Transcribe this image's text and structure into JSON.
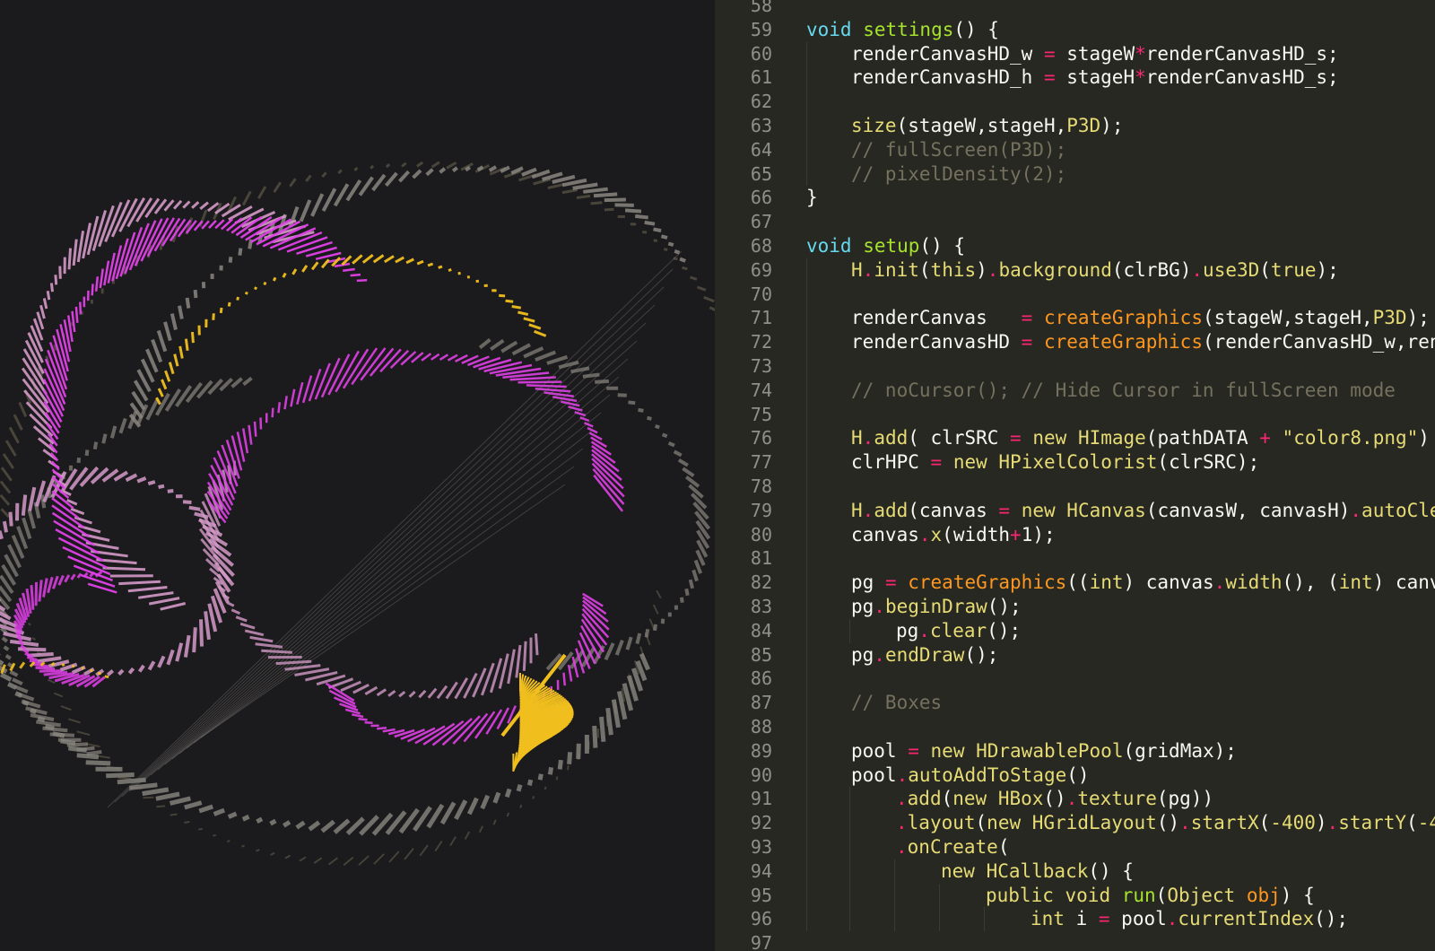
{
  "colors": {
    "canvas_bg": "#1b1a1c",
    "editor_bg": "#272822",
    "magenta": "#e040e8",
    "pink": "#d49ac8",
    "gold": "#f0bf1e",
    "gray": "#8a8780",
    "olive": "#6f6a55"
  },
  "editor": {
    "lines": [
      {
        "num": "58",
        "indent": 0,
        "tokens": []
      },
      {
        "num": "59",
        "indent": 0,
        "tokens": [
          {
            "t": "void ",
            "c": "kw2"
          },
          {
            "t": "settings",
            "c": "fn"
          },
          {
            "t": "() {",
            "c": "plain"
          }
        ]
      },
      {
        "num": "60",
        "indent": 1,
        "tokens": [
          {
            "t": "renderCanvasHD_w ",
            "c": "plain"
          },
          {
            "t": "=",
            "c": "op"
          },
          {
            "t": " stageW",
            "c": "plain"
          },
          {
            "t": "*",
            "c": "op"
          },
          {
            "t": "renderCanvasHD_s;",
            "c": "plain"
          }
        ]
      },
      {
        "num": "61",
        "indent": 1,
        "tokens": [
          {
            "t": "renderCanvasHD_h ",
            "c": "plain"
          },
          {
            "t": "=",
            "c": "op"
          },
          {
            "t": " stageH",
            "c": "plain"
          },
          {
            "t": "*",
            "c": "op"
          },
          {
            "t": "renderCanvasHD_s;",
            "c": "plain"
          }
        ]
      },
      {
        "num": "62",
        "indent": 0,
        "tokens": []
      },
      {
        "num": "63",
        "indent": 1,
        "tokens": [
          {
            "t": "size",
            "c": "call"
          },
          {
            "t": "(stageW,stageH,",
            "c": "plain"
          },
          {
            "t": "P3D",
            "c": "call"
          },
          {
            "t": ");",
            "c": "plain"
          }
        ]
      },
      {
        "num": "64",
        "indent": 1,
        "tokens": [
          {
            "t": "// fullScreen(P3D);",
            "c": "cm"
          }
        ]
      },
      {
        "num": "65",
        "indent": 1,
        "tokens": [
          {
            "t": "// pixelDensity(2);",
            "c": "cm"
          }
        ]
      },
      {
        "num": "66",
        "indent": 0,
        "tokens": [
          {
            "t": "}",
            "c": "plain"
          }
        ]
      },
      {
        "num": "67",
        "indent": 0,
        "tokens": []
      },
      {
        "num": "68",
        "indent": 0,
        "tokens": [
          {
            "t": "void ",
            "c": "kw2"
          },
          {
            "t": "setup",
            "c": "fn"
          },
          {
            "t": "() {",
            "c": "plain"
          }
        ]
      },
      {
        "num": "69",
        "indent": 1,
        "tokens": [
          {
            "t": "H",
            "c": "call"
          },
          {
            "t": ".",
            "c": "op"
          },
          {
            "t": "init",
            "c": "call"
          },
          {
            "t": "(",
            "c": "plain"
          },
          {
            "t": "this",
            "c": "call"
          },
          {
            "t": ")",
            "c": "plain"
          },
          {
            "t": ".",
            "c": "op"
          },
          {
            "t": "background",
            "c": "call"
          },
          {
            "t": "(clrBG)",
            "c": "plain"
          },
          {
            "t": ".",
            "c": "op"
          },
          {
            "t": "use3D",
            "c": "call"
          },
          {
            "t": "(",
            "c": "plain"
          },
          {
            "t": "true",
            "c": "call"
          },
          {
            "t": ");",
            "c": "plain"
          }
        ]
      },
      {
        "num": "70",
        "indent": 0,
        "tokens": []
      },
      {
        "num": "71",
        "indent": 1,
        "tokens": [
          {
            "t": "renderCanvas   ",
            "c": "plain"
          },
          {
            "t": "=",
            "c": "op"
          },
          {
            "t": " ",
            "c": "plain"
          },
          {
            "t": "createGraphics",
            "c": "const"
          },
          {
            "t": "(stageW,stageH,",
            "c": "plain"
          },
          {
            "t": "P3D",
            "c": "call"
          },
          {
            "t": ");",
            "c": "plain"
          }
        ]
      },
      {
        "num": "72",
        "indent": 1,
        "tokens": [
          {
            "t": "renderCanvasHD ",
            "c": "plain"
          },
          {
            "t": "=",
            "c": "op"
          },
          {
            "t": " ",
            "c": "plain"
          },
          {
            "t": "createGraphics",
            "c": "const"
          },
          {
            "t": "(renderCanvasHD_w,rend",
            "c": "plain"
          }
        ]
      },
      {
        "num": "73",
        "indent": 0,
        "tokens": []
      },
      {
        "num": "74",
        "indent": 1,
        "tokens": [
          {
            "t": "// noCursor(); // Hide Cursor in fullScreen mode",
            "c": "cm"
          }
        ]
      },
      {
        "num": "75",
        "indent": 0,
        "tokens": []
      },
      {
        "num": "76",
        "indent": 1,
        "tokens": [
          {
            "t": "H",
            "c": "call"
          },
          {
            "t": ".",
            "c": "op"
          },
          {
            "t": "add",
            "c": "call"
          },
          {
            "t": "( clrSRC ",
            "c": "plain"
          },
          {
            "t": "=",
            "c": "op"
          },
          {
            "t": " ",
            "c": "plain"
          },
          {
            "t": "new ",
            "c": "call"
          },
          {
            "t": "HImage",
            "c": "call"
          },
          {
            "t": "(pathDATA ",
            "c": "plain"
          },
          {
            "t": "+",
            "c": "op"
          },
          {
            "t": " ",
            "c": "plain"
          },
          {
            "t": "\"color8.png\"",
            "c": "str"
          },
          {
            "t": ")",
            "c": "plain"
          }
        ]
      },
      {
        "num": "77",
        "indent": 1,
        "tokens": [
          {
            "t": "clrHPC ",
            "c": "plain"
          },
          {
            "t": "=",
            "c": "op"
          },
          {
            "t": " ",
            "c": "plain"
          },
          {
            "t": "new ",
            "c": "call"
          },
          {
            "t": "HPixelColorist",
            "c": "call"
          },
          {
            "t": "(clrSRC);",
            "c": "plain"
          }
        ]
      },
      {
        "num": "78",
        "indent": 0,
        "tokens": []
      },
      {
        "num": "79",
        "indent": 1,
        "tokens": [
          {
            "t": "H",
            "c": "call"
          },
          {
            "t": ".",
            "c": "op"
          },
          {
            "t": "add",
            "c": "call"
          },
          {
            "t": "(canvas ",
            "c": "plain"
          },
          {
            "t": "=",
            "c": "op"
          },
          {
            "t": " ",
            "c": "plain"
          },
          {
            "t": "new ",
            "c": "call"
          },
          {
            "t": "HCanvas",
            "c": "call"
          },
          {
            "t": "(canvasW, canvasH)",
            "c": "plain"
          },
          {
            "t": ".",
            "c": "op"
          },
          {
            "t": "autoCle",
            "c": "call"
          }
        ]
      },
      {
        "num": "80",
        "indent": 1,
        "tokens": [
          {
            "t": "canvas",
            "c": "plain"
          },
          {
            "t": ".",
            "c": "op"
          },
          {
            "t": "x",
            "c": "call"
          },
          {
            "t": "(width",
            "c": "plain"
          },
          {
            "t": "+",
            "c": "op"
          },
          {
            "t": "1);",
            "c": "plain"
          }
        ]
      },
      {
        "num": "81",
        "indent": 0,
        "tokens": []
      },
      {
        "num": "82",
        "indent": 1,
        "tokens": [
          {
            "t": "pg ",
            "c": "plain"
          },
          {
            "t": "=",
            "c": "op"
          },
          {
            "t": " ",
            "c": "plain"
          },
          {
            "t": "createGraphics",
            "c": "const"
          },
          {
            "t": "((",
            "c": "plain"
          },
          {
            "t": "int",
            "c": "call"
          },
          {
            "t": ") canvas",
            "c": "plain"
          },
          {
            "t": ".",
            "c": "op"
          },
          {
            "t": "width",
            "c": "call"
          },
          {
            "t": "(), (",
            "c": "plain"
          },
          {
            "t": "int",
            "c": "call"
          },
          {
            "t": ") canv",
            "c": "plain"
          }
        ]
      },
      {
        "num": "83",
        "indent": 1,
        "tokens": [
          {
            "t": "pg",
            "c": "plain"
          },
          {
            "t": ".",
            "c": "op"
          },
          {
            "t": "beginDraw",
            "c": "call"
          },
          {
            "t": "();",
            "c": "plain"
          }
        ]
      },
      {
        "num": "84",
        "indent": 2,
        "tokens": [
          {
            "t": "pg",
            "c": "plain"
          },
          {
            "t": ".",
            "c": "op"
          },
          {
            "t": "clear",
            "c": "call"
          },
          {
            "t": "();",
            "c": "plain"
          }
        ]
      },
      {
        "num": "85",
        "indent": 1,
        "tokens": [
          {
            "t": "pg",
            "c": "plain"
          },
          {
            "t": ".",
            "c": "op"
          },
          {
            "t": "endDraw",
            "c": "call"
          },
          {
            "t": "();",
            "c": "plain"
          }
        ]
      },
      {
        "num": "86",
        "indent": 0,
        "tokens": []
      },
      {
        "num": "87",
        "indent": 1,
        "tokens": [
          {
            "t": "// Boxes",
            "c": "cm"
          }
        ]
      },
      {
        "num": "88",
        "indent": 0,
        "tokens": []
      },
      {
        "num": "89",
        "indent": 1,
        "tokens": [
          {
            "t": "pool ",
            "c": "plain"
          },
          {
            "t": "=",
            "c": "op"
          },
          {
            "t": " ",
            "c": "plain"
          },
          {
            "t": "new ",
            "c": "call"
          },
          {
            "t": "HDrawablePool",
            "c": "call"
          },
          {
            "t": "(gridMax);",
            "c": "plain"
          }
        ]
      },
      {
        "num": "90",
        "indent": 1,
        "tokens": [
          {
            "t": "pool",
            "c": "plain"
          },
          {
            "t": ".",
            "c": "op"
          },
          {
            "t": "autoAddToStage",
            "c": "call"
          },
          {
            "t": "()",
            "c": "plain"
          }
        ]
      },
      {
        "num": "91",
        "indent": 2,
        "tokens": [
          {
            "t": ".",
            "c": "op"
          },
          {
            "t": "add",
            "c": "call"
          },
          {
            "t": "(",
            "c": "plain"
          },
          {
            "t": "new ",
            "c": "call"
          },
          {
            "t": "HBox",
            "c": "call"
          },
          {
            "t": "()",
            "c": "plain"
          },
          {
            "t": ".",
            "c": "op"
          },
          {
            "t": "texture",
            "c": "call"
          },
          {
            "t": "(pg))",
            "c": "plain"
          }
        ]
      },
      {
        "num": "92",
        "indent": 2,
        "tokens": [
          {
            "t": ".",
            "c": "op"
          },
          {
            "t": "layout",
            "c": "call"
          },
          {
            "t": "(",
            "c": "plain"
          },
          {
            "t": "new ",
            "c": "call"
          },
          {
            "t": "HGridLayout",
            "c": "call"
          },
          {
            "t": "()",
            "c": "plain"
          },
          {
            "t": ".",
            "c": "op"
          },
          {
            "t": "startX",
            "c": "call"
          },
          {
            "t": "(",
            "c": "plain"
          },
          {
            "t": "-400",
            "c": "call"
          },
          {
            "t": ")",
            "c": "plain"
          },
          {
            "t": ".",
            "c": "op"
          },
          {
            "t": "startY",
            "c": "call"
          },
          {
            "t": "(",
            "c": "plain"
          },
          {
            "t": "-4",
            "c": "call"
          }
        ]
      },
      {
        "num": "93",
        "indent": 2,
        "tokens": [
          {
            "t": ".",
            "c": "op"
          },
          {
            "t": "onCreate",
            "c": "call"
          },
          {
            "t": "(",
            "c": "plain"
          }
        ]
      },
      {
        "num": "94",
        "indent": 3,
        "tokens": [
          {
            "t": "new ",
            "c": "call"
          },
          {
            "t": "HCallback",
            "c": "call"
          },
          {
            "t": "() {",
            "c": "plain"
          }
        ]
      },
      {
        "num": "95",
        "indent": 4,
        "tokens": [
          {
            "t": "public ",
            "c": "call"
          },
          {
            "t": "void ",
            "c": "call"
          },
          {
            "t": "run",
            "c": "fn"
          },
          {
            "t": "(",
            "c": "plain"
          },
          {
            "t": "Object",
            "c": "call"
          },
          {
            "t": " ",
            "c": "plain"
          },
          {
            "t": "obj",
            "c": "const"
          },
          {
            "t": ") {",
            "c": "plain"
          }
        ]
      },
      {
        "num": "96",
        "indent": 5,
        "tokens": [
          {
            "t": "int",
            "c": "call"
          },
          {
            "t": " i ",
            "c": "plain"
          },
          {
            "t": "=",
            "c": "op"
          },
          {
            "t": " pool",
            "c": "plain"
          },
          {
            "t": ".",
            "c": "op"
          },
          {
            "t": "currentIndex",
            "c": "call"
          },
          {
            "t": "();",
            "c": "plain"
          }
        ]
      },
      {
        "num": "97",
        "indent": 0,
        "tokens": []
      }
    ]
  }
}
